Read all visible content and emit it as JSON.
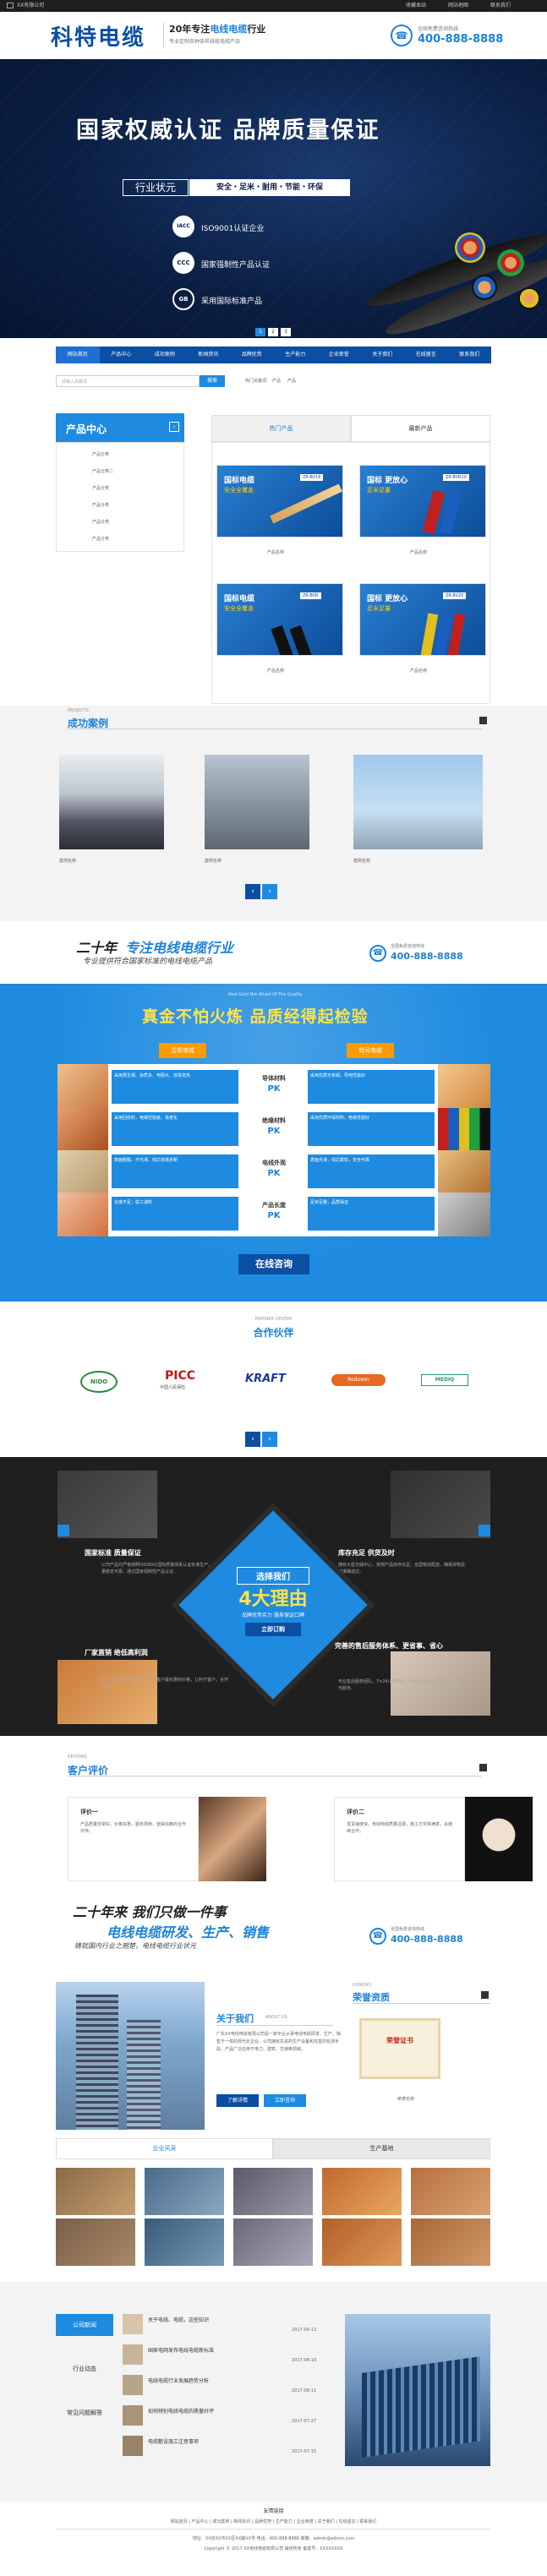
{
  "topbar": {
    "company": "XX有限公司",
    "links": [
      "收藏本站",
      "网站地图",
      "联系我们"
    ]
  },
  "header": {
    "logo": "科特电缆",
    "slogan_prefix": "20年专注",
    "slogan_em": "电线电缆",
    "slogan_suffix": "行业",
    "slogan_sub": "专业定制各种各样线缆电缆产品",
    "hotline_label": "全国免费咨询热线",
    "hotline": "400-888-8888"
  },
  "hero": {
    "title": "国家权威认证  品牌质量保证",
    "badge": "行业状元",
    "tags": "安全・足米・耐用・节能・环保",
    "items": [
      "ISO9001认证企业",
      "国家强制性产品认证",
      "采用国际标准产品"
    ],
    "dots": [
      "1",
      "2",
      "3"
    ],
    "icons": [
      "iacc",
      "ccc",
      "gb"
    ]
  },
  "nav": [
    "网站首页",
    "产品中心",
    "成功案例",
    "新闻资讯",
    "品牌优势",
    "生产能力",
    "企业荣誉",
    "关于我们",
    "在线留言",
    "联系我们"
  ],
  "search": {
    "placeholder": "请输入关键词",
    "button": "搜索",
    "hot_label": "热门关键词：",
    "hot_words": [
      "产品",
      "产品"
    ]
  },
  "sidebar": {
    "title": "产品中心",
    "items": [
      "产品分类",
      "产品分类二",
      "产品分类",
      "产品分类",
      "产品分类",
      "产品分类"
    ]
  },
  "products": {
    "tabs": [
      "热门产品",
      "最新产品"
    ],
    "items": [
      {
        "label": "产品名称",
        "model": "ZR-BV16",
        "headline": "国标电缆",
        "sub": "安全全覆盖"
      },
      {
        "label": "产品名称",
        "model": "ZR-BVR10",
        "headline": "国标 更放心",
        "sub": "足米足量"
      },
      {
        "label": "产品名称",
        "model": "ZR-BVR",
        "headline": "国标电缆",
        "sub": "安全全覆盖"
      },
      {
        "label": "产品名称",
        "model": "ZR-BV25",
        "headline": "国标 更放心",
        "sub": "足米足量"
      }
    ]
  },
  "cases": {
    "en": "PROJECTS",
    "title": "成功案例",
    "items": [
      "案例名称",
      "案例名称",
      "案例名称",
      "案例名称"
    ],
    "arrows": [
      "‹",
      "›"
    ]
  },
  "banner1": {
    "line1a": "二十年",
    "line1b": "专注电线电缆行业",
    "line2": "专业提供符合国家标准的电线电缆产品",
    "hotline_label": "全国免费咨询热线",
    "hotline": "400-888-8888"
  },
  "compare": {
    "small_top": "Real Gold Not Afraid Of Fire Quality",
    "title": "真金不怕火炼  品质经得起检验",
    "left_tag": "劣质电缆",
    "right_tag": "我司电缆",
    "pk_rows": [
      {
        "label": "导体材料",
        "pk": "PK",
        "left": "采用再生铜、杂质多、电阻大、容易发热",
        "right": "采用优质无氧铜，导电性能好"
      },
      {
        "label": "绝缘材料",
        "pk": "PK",
        "left": "采用回收料，绝缘性能差、易老化",
        "right": "采用优质环保材料，绝缘性能好"
      },
      {
        "label": "电线外观",
        "pk": "PK",
        "left": "表面粗糙、不光滑、线芯容易折断",
        "right": "表面光滑，线芯柔软，安全可靠"
      },
      {
        "label": "产品长度",
        "pk": "PK",
        "left": "长度不足，偷工减料",
        "right": "足米足量，品质保证"
      }
    ],
    "button": "在线咨询"
  },
  "partners": {
    "en": "PARTNER CENTER",
    "title": "合作伙伴",
    "logos": [
      "NIDO",
      "PICC",
      "KRAFT",
      "Redoxon",
      "MEDIQ"
    ],
    "subs": [
      "",
      "中国人民保险",
      "",
      "",
      ""
    ],
    "arrows": [
      "‹",
      "›"
    ]
  },
  "reasons": {
    "center_top": "选择我们",
    "center_big": "4大理由",
    "center_sub": "品牌优势实力 服务保证口碑",
    "center_btn": "立即订购",
    "items": [
      {
        "title": "国家标准  质量保证",
        "text": "公司产品均严格按照ISO9001国际质量体系认证标准生产，产品质量稳定可靠，通过国家强制性产品认证。"
      },
      {
        "title": "库存充足  供货及时",
        "text": "拥有大型仓储中心，常规产品库存充足，全国物流配送，确保货物及时准确送达。"
      },
      {
        "title": "厂家直销  绝低高利润",
        "text": "工厂直销，省去中间环节，给客户最实惠的价格，让利于客户，合作共赢。"
      },
      {
        "title": "完善的售后服务体系、更省事、省心",
        "text": "专业售后服务团队，7×24小时响应，为客户提供全方位的技术支持与服务。"
      }
    ]
  },
  "reviews": {
    "en": "REVIEWS",
    "title": "客户评价",
    "items": [
      {
        "name": "评价一",
        "text": "产品质量非常好，价格实惠，服务周到，值得信赖的合作伙伴。"
      },
      {
        "name": "评价二",
        "text": "发货速度快，电线电缆质量过硬，施工方非常满意，会继续合作。"
      }
    ]
  },
  "banner2": {
    "line1": "二十年来  我们只做一件事",
    "line2": "电线电缆研发、生产、销售",
    "line3": "铸就国内行业之翘楚，电线电缆行业状元",
    "hotline_label": "全国免费咨询热线",
    "hotline": "400-888-8888"
  },
  "about": {
    "title": "关于我们",
    "en": "ABOUT US",
    "text": "广东XX电线电缆有限公司是一家专业从事电线电缆研发、生产、销售于一体的现代化企业，公司拥有先进的生产设备和完善的检测手段，产品广泛应用于电力、建筑、交通等领域。",
    "btn1": "了解详情",
    "btn2": "立即咨询",
    "honor_en": "HONORS",
    "honor_title": "荣誉资质",
    "honor_cert": "荣誉证书",
    "honor_label": "荣誉名称"
  },
  "styletabs": [
    "企业风采",
    "生产基地"
  ],
  "news": {
    "cats": [
      "公司新闻",
      "行业动态",
      "常见问题解答"
    ],
    "items": [
      {
        "title": "关于电线、电缆，这些知识",
        "date": "2017-09-13"
      },
      {
        "title": "国家电网发布电线电缆新标准",
        "date": "2017-08-19"
      },
      {
        "title": "电线电缆行业发展趋势分析",
        "date": "2017-08-11"
      },
      {
        "title": "如何辨别电线电缆的质量好坏",
        "date": "2017-07-27"
      },
      {
        "title": "电缆敷设施工注意事项",
        "date": "2017-07-15"
      }
    ]
  },
  "footer": {
    "links_label": "友情链接",
    "links": "网站首页 | 产品中心 | 成功案例 | 新闻资讯 | 品牌优势 | 生产能力 | 企业荣誉 | 关于我们 | 在线留言 | 联系我们",
    "line1": "地址：XX省XX市XX区XX路XX号  电话：400-888-8888  邮箱：admin@admin.com",
    "line2": "Copyright © 2017 XX电线电缆有限公司 版权所有  备案号：XXXXXXXX"
  }
}
